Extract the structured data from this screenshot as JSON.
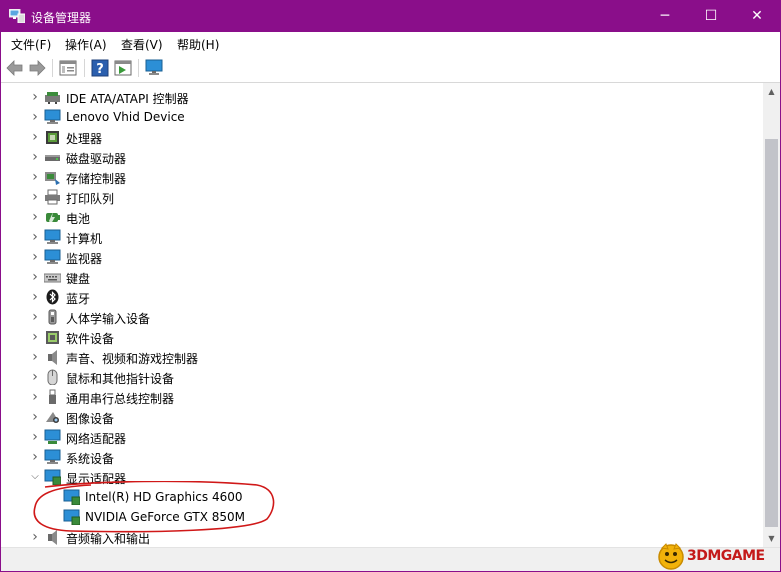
{
  "window": {
    "title": "设备管理器",
    "accent_color": "#8a0e8a"
  },
  "title_controls": {
    "minimize": "─",
    "maximize": "☐",
    "close": "✕"
  },
  "menu": {
    "file": "文件(F)",
    "action": "操作(A)",
    "view": "查看(V)",
    "help": "帮助(H)"
  },
  "toolbar": [
    "back-icon",
    "forward-icon",
    "properties-icon",
    "help-icon",
    "run-icon",
    "monitor-icon"
  ],
  "tree": {
    "items": [
      {
        "label": "IDE ATA/ATAPI 控制器",
        "icon": "ide-controller-icon",
        "expanded": false
      },
      {
        "label": "Lenovo Vhid Device",
        "icon": "monitor-icon",
        "expanded": false
      },
      {
        "label": "处理器",
        "icon": "processor-icon",
        "expanded": false
      },
      {
        "label": "磁盘驱动器",
        "icon": "disk-drive-icon",
        "expanded": false
      },
      {
        "label": "存储控制器",
        "icon": "storage-controller-icon",
        "expanded": false
      },
      {
        "label": "打印队列",
        "icon": "printer-icon",
        "expanded": false
      },
      {
        "label": "电池",
        "icon": "battery-icon",
        "expanded": false
      },
      {
        "label": "计算机",
        "icon": "computer-icon",
        "expanded": false
      },
      {
        "label": "监视器",
        "icon": "monitor-icon",
        "expanded": false
      },
      {
        "label": "键盘",
        "icon": "keyboard-icon",
        "expanded": false
      },
      {
        "label": "蓝牙",
        "icon": "bluetooth-icon",
        "expanded": false
      },
      {
        "label": "人体学输入设备",
        "icon": "hid-icon",
        "expanded": false
      },
      {
        "label": "软件设备",
        "icon": "software-device-icon",
        "expanded": false
      },
      {
        "label": "声音、视频和游戏控制器",
        "icon": "speaker-icon",
        "expanded": false
      },
      {
        "label": "鼠标和其他指针设备",
        "icon": "mouse-icon",
        "expanded": false
      },
      {
        "label": "通用串行总线控制器",
        "icon": "usb-icon",
        "expanded": false
      },
      {
        "label": "图像设备",
        "icon": "camera-icon",
        "expanded": false
      },
      {
        "label": "网络适配器",
        "icon": "network-icon",
        "expanded": false
      },
      {
        "label": "系统设备",
        "icon": "system-device-icon",
        "expanded": false
      },
      {
        "label": "显示适配器",
        "icon": "display-adapter-icon",
        "expanded": true,
        "children": [
          {
            "label": "Intel(R) HD Graphics 4600",
            "icon": "display-adapter-icon"
          },
          {
            "label": "NVIDIA GeForce GTX 850M",
            "icon": "display-adapter-icon"
          }
        ]
      },
      {
        "label": "音频输入和输出",
        "icon": "speaker-icon",
        "expanded": false
      }
    ]
  },
  "watermark": {
    "text": "3DMGAME",
    "color": "#c41a1a"
  }
}
